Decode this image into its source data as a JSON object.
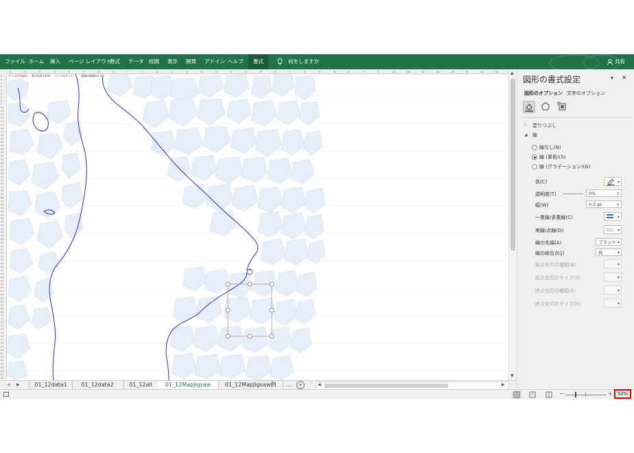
{
  "ribbon": {
    "tabs": [
      "ファイル",
      "ホーム",
      "挿入",
      "ページ レイアウト",
      "数式",
      "データ",
      "校閲",
      "表示",
      "開発",
      "アドイン",
      "ヘルプ",
      "書式"
    ],
    "tell_me": "何をしますか",
    "share": "共有",
    "bg_color": "#217346"
  },
  "sheet": {
    "cell_notes": [
      "サイズ50%縮小",
      "表示倍率100%",
      "ヒント&ゲット",
      "地図の線幅を0.5pt"
    ],
    "col_headers": [
      "A",
      "B",
      "C",
      "D",
      "E",
      "F",
      "G",
      "H",
      "I",
      "J",
      "K",
      "L",
      "M",
      "N",
      "O",
      "P",
      "Q",
      "R",
      "S",
      "T",
      "U",
      "V",
      "W",
      "X",
      "Y",
      "Z",
      "AA",
      "AB",
      "AC",
      "AD",
      "AE",
      "AF",
      "AG",
      "AH"
    ],
    "map_line_color": "#2b2bd8",
    "piece_color": "#e6eef8"
  },
  "pane": {
    "title": "図形の書式設定",
    "tabs": [
      "図形のオプション",
      "文字のオプション"
    ],
    "fill_section": "塗りつぶし",
    "line_section": "線",
    "line_none": "線なし(N)",
    "line_solid": "線 (単色)(S)",
    "line_gradient": "線 (グラデーション)(G)",
    "color_label": "色(C)",
    "transparency_label": "透明度(T)",
    "transparency_value": "0%",
    "width_label": "幅(W)",
    "width_value": "0.5 pt",
    "compound_label": "一重線/多重線(C)",
    "dash_label": "実線/点線(D)",
    "cap_label": "線の先端(A)",
    "cap_value": "フラット",
    "join_label": "線の結合点(J)",
    "join_value": "丸",
    "begin_arrow_type": "始点矢印の種類(B)",
    "begin_arrow_size": "始点矢印のサイズ(S)",
    "end_arrow_type": "終点矢印の種類(E)",
    "end_arrow_size": "終点矢印のサイズ(N)",
    "close_glyph": "✕",
    "collapse_glyph": "▾"
  },
  "sheet_tabs": {
    "tabs": [
      "01_12data1",
      "01_12data2",
      "01_12all",
      "01_12MapJigsaw",
      "01_12MapJigsaw例"
    ],
    "active_index": 3,
    "more": "...",
    "add": "+"
  },
  "status": {
    "zoom": "50%",
    "zoom_minus": "−",
    "zoom_plus": "+"
  }
}
